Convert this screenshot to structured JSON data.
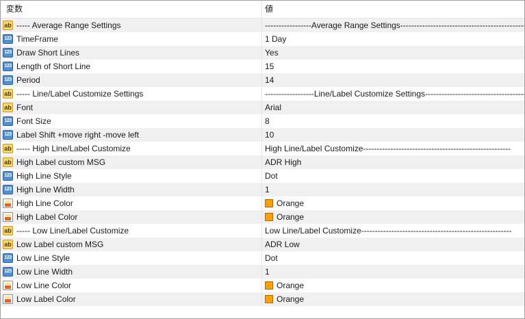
{
  "header": {
    "name_col": "変数",
    "value_col": "値"
  },
  "rows": [
    {
      "icon": "ab-icon",
      "name": "----- Average Range Settings",
      "value": "-----------------Average Range Settings-------------------------------------------------"
    },
    {
      "icon": "number-icon",
      "name": "TimeFrame",
      "value": "1 Day"
    },
    {
      "icon": "number-icon",
      "name": "Draw Short Lines",
      "value": "Yes"
    },
    {
      "icon": "number-icon",
      "name": "Length of Short Line",
      "value": "15"
    },
    {
      "icon": "number-icon",
      "name": "Period",
      "value": "14"
    },
    {
      "icon": "ab-icon",
      "name": "----- Line/Label Customize  Settings",
      "value": "------------------Line/Label Customize  Settings--------------------------------------"
    },
    {
      "icon": "ab-icon",
      "name": "Font",
      "value": "Arial"
    },
    {
      "icon": "number-icon",
      "name": "Font Size",
      "value": "8"
    },
    {
      "icon": "number-icon",
      "name": "Label Shift +move right -move left",
      "value": "10"
    },
    {
      "icon": "ab-icon",
      "name": "----- High Line/Label Customize",
      "value": "High Line/Label Customize------------------------------------------------------"
    },
    {
      "icon": "ab-icon",
      "name": "High Label custom MSG",
      "value": "ADR High"
    },
    {
      "icon": "number-icon",
      "name": "High Line Style",
      "value": "Dot"
    },
    {
      "icon": "number-icon",
      "name": "High Line Width",
      "value": "1"
    },
    {
      "icon": "color-icon",
      "name": "High Line Color",
      "value": "Orange",
      "swatch": "#ff9f00"
    },
    {
      "icon": "color-icon",
      "name": "High Label Color",
      "value": "Orange",
      "swatch": "#ff9f00"
    },
    {
      "icon": "ab-icon",
      "name": "----- Low Line/Label Customize",
      "value": "Low Line/Label Customize-------------------------------------------------------"
    },
    {
      "icon": "ab-icon",
      "name": "Low Label custom MSG",
      "value": "ADR Low"
    },
    {
      "icon": "number-icon",
      "name": "Low Line Style",
      "value": "Dot"
    },
    {
      "icon": "number-icon",
      "name": "Low Line Width",
      "value": "1"
    },
    {
      "icon": "color-icon",
      "name": "Low Line Color",
      "value": "Orange",
      "swatch": "#ff9f00"
    },
    {
      "icon": "color-icon",
      "name": "Low Label Color",
      "value": "Orange",
      "swatch": "#ff9f00"
    }
  ]
}
